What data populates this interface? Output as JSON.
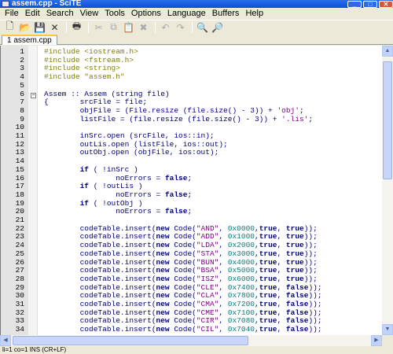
{
  "window": {
    "title": "assem.cpp - SciTE"
  },
  "menu": [
    "File",
    "Edit",
    "Search",
    "View",
    "Tools",
    "Options",
    "Language",
    "Buffers",
    "Help"
  ],
  "tab": {
    "label": "1 assem.cpp"
  },
  "statusbar": {
    "text": "li=1 co=1 INS (CR+LF)"
  },
  "colors": {
    "comment_green": "#007f00",
    "preproc": "#7f7f00",
    "string": "#7f007f",
    "keyword": "#00007f",
    "number": "#007f7f"
  },
  "code_lines": [
    {
      "n": "1",
      "text": "#include <iostream.h>"
    },
    {
      "n": "2",
      "text": "#include <fstream.h>"
    },
    {
      "n": "3",
      "text": "#include <string>"
    },
    {
      "n": "4",
      "text": "#include \"assem.h\""
    },
    {
      "n": "5",
      "text": ""
    },
    {
      "n": "6",
      "text": "Assem :: Assem (string file)"
    },
    {
      "n": "7",
      "text": "{       srcFile = file;"
    },
    {
      "n": "8",
      "text": "        objFile = (File.resize (file.size() - 3)) + 'obj';"
    },
    {
      "n": "9",
      "text": "        listFile = (file.resize (file.size() - 3)) + '.lis';"
    },
    {
      "n": "10",
      "text": ""
    },
    {
      "n": "11",
      "text": "        inSrc.open (srcFile, ios::in);"
    },
    {
      "n": "12",
      "text": "        outLis.open (listFile, ios::out);"
    },
    {
      "n": "13",
      "text": "        outObj.open (objFile, ios:out);"
    },
    {
      "n": "14",
      "text": ""
    },
    {
      "n": "15",
      "text": "        if ( !inSrc )"
    },
    {
      "n": "16",
      "text": "                noErrors = false;"
    },
    {
      "n": "17",
      "text": "        if ( !outLis )"
    },
    {
      "n": "18",
      "text": "                noErrors = false;"
    },
    {
      "n": "19",
      "text": "        if ( !outObj )"
    },
    {
      "n": "20",
      "text": "                noErrors = false;"
    },
    {
      "n": "21",
      "text": ""
    },
    {
      "n": "22",
      "text": "        codeTable.insert(new Code(\"AND\", 0x0000,true, true));"
    },
    {
      "n": "23",
      "text": "        codeTable.insert(new Code(\"ADD\", 0x1000,true, true));"
    },
    {
      "n": "24",
      "text": "        codeTable.insert(new Code(\"LDA\", 0x2000,true, true));"
    },
    {
      "n": "25",
      "text": "        codeTable.insert(new Code(\"STA\", 0x3000,true, true));"
    },
    {
      "n": "26",
      "text": "        codeTable.insert(new Code(\"BUN\", 0x4000,true, true));"
    },
    {
      "n": "27",
      "text": "        codeTable.insert(new Code(\"BSA\", 0x5000,true, true));"
    },
    {
      "n": "28",
      "text": "        codeTable.insert(new Code(\"ISZ\", 0x6000,true, true));"
    },
    {
      "n": "29",
      "text": "        codeTable.insert(new Code(\"CLE\", 0x7400,true, false));"
    },
    {
      "n": "30",
      "text": "        codeTable.insert(new Code(\"CLA\", 0x7800,true, false));"
    },
    {
      "n": "31",
      "text": "        codeTable.insert(new Code(\"CMA\", 0x7200,true, false));"
    },
    {
      "n": "32",
      "text": "        codeTable.insert(new Code(\"CME\", 0x7100,true, false));"
    },
    {
      "n": "33",
      "text": "        codeTable.insert(new Code(\"CIR\", 0x7080,true, false));"
    },
    {
      "n": "34",
      "text": "        codeTable.insert(new Code(\"CIL\", 0x7040,true, false));"
    }
  ]
}
